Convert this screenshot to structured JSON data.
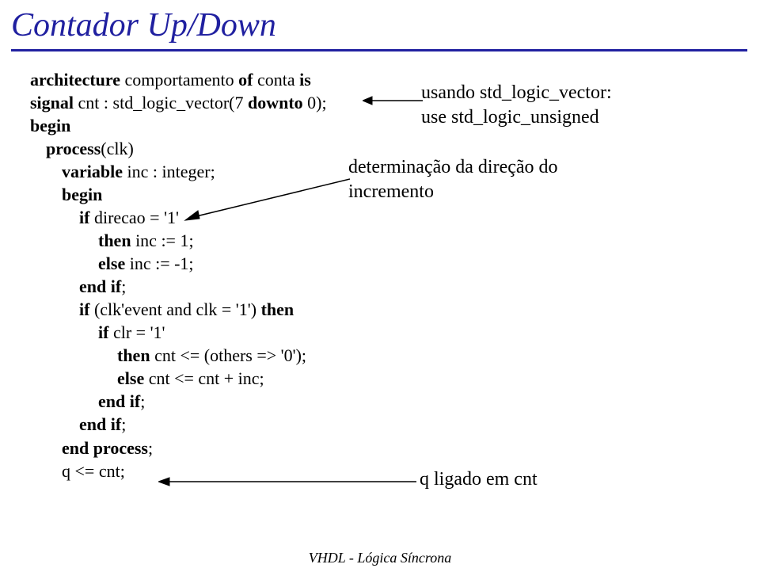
{
  "title": "Contador Up/Down",
  "code": {
    "l1a": "architecture",
    "l1b": " comportamento ",
    "l1c": "of",
    "l1d": " conta ",
    "l1e": "is",
    "l2a": "signal",
    "l2b": " cnt : std_logic_vector(7 ",
    "l2c": "downto",
    "l2d": " 0);",
    "l3": "begin",
    "l4a": "process",
    "l4b": "(clk)",
    "l5a": "variable",
    "l5b": " inc : integer;",
    "l6": "begin",
    "l7a": "if",
    "l7b": " direcao = '1'",
    "l8a": "then",
    "l8b": " inc := 1;",
    "l9a": "else",
    "l9b": " inc := -1;",
    "l10a": "end if",
    "l10b": ";",
    "l11a": "if",
    "l11b": " (clk'event and clk = '1') ",
    "l11c": "then",
    "l12a": "if",
    "l12b": " clr = '1'",
    "l13a": "then",
    "l13b": " cnt <= (others => '0');",
    "l14a": "else",
    "l14b": " cnt <= cnt + inc;",
    "l15": "end if",
    "l15b": ";",
    "l16": "end if",
    "l16b": ";",
    "l17": "end process",
    "l17b": ";",
    "l18": "q <= cnt;"
  },
  "annotations": {
    "a1_line1": "usando std_logic_vector:",
    "a1_line2": "use std_logic_unsigned",
    "a2_line1": "determinação da direção do",
    "a2_line2": "incremento",
    "a3": "q ligado em cnt"
  },
  "footer": "VHDL - Lógica Síncrona"
}
